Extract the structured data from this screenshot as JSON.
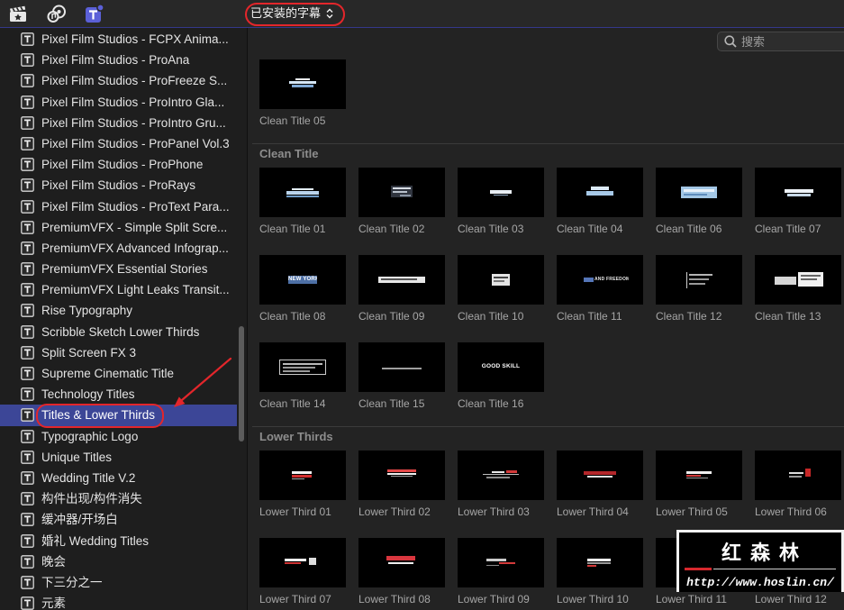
{
  "toolbar": {
    "icons": {
      "libraries": "clapperboard-icon",
      "photos_audio": "photos-audio-icon",
      "titles_generators": "titles-generators-icon"
    },
    "browser_menu_label": "已安装的字幕"
  },
  "search": {
    "placeholder": "搜索"
  },
  "sidebar": {
    "selected_index": 18,
    "items": [
      {
        "label": "Pixel Film Studios - FCPX Anima..."
      },
      {
        "label": "Pixel Film Studios - ProAna"
      },
      {
        "label": "Pixel Film Studios - ProFreeze S..."
      },
      {
        "label": "Pixel Film Studios - ProIntro Gla..."
      },
      {
        "label": "Pixel Film Studios - ProIntro Gru..."
      },
      {
        "label": "Pixel Film Studios - ProPanel Vol.3"
      },
      {
        "label": "Pixel Film Studios - ProPhone"
      },
      {
        "label": "Pixel Film Studios - ProRays"
      },
      {
        "label": "Pixel Film Studios - ProText Para..."
      },
      {
        "label": "PremiumVFX - Simple Split Scre..."
      },
      {
        "label": "PremiumVFX Advanced Infograp..."
      },
      {
        "label": "PremiumVFX Essential Stories"
      },
      {
        "label": "PremiumVFX Light Leaks Transit..."
      },
      {
        "label": "Rise Typography"
      },
      {
        "label": "Scribble Sketch Lower Thirds"
      },
      {
        "label": "Split Screen FX 3"
      },
      {
        "label": "Supreme Cinematic Title"
      },
      {
        "label": "Technology Titles"
      },
      {
        "label": "Titles & Lower Thirds"
      },
      {
        "label": "Typographic Logo"
      },
      {
        "label": "Unique Titles"
      },
      {
        "label": "Wedding Title V.2"
      },
      {
        "label": "构件出现/构件消失"
      },
      {
        "label": "缓冲器/开场白"
      },
      {
        "label": "婚礼 Wedding Titles"
      },
      {
        "label": "晚会"
      },
      {
        "label": "下三分之一"
      },
      {
        "label": "元素"
      }
    ]
  },
  "browser": {
    "sections": [
      {
        "tiles": [
          {
            "label": "Clean Title 05"
          }
        ]
      },
      {
        "header": "Clean Title",
        "tiles": [
          {
            "label": "Clean Title 01"
          },
          {
            "label": "Clean Title 02"
          },
          {
            "label": "Clean Title 03"
          },
          {
            "label": "Clean Title 04"
          },
          {
            "label": "Clean Title 06"
          },
          {
            "label": "Clean Title 07"
          },
          {
            "label": "Clean Title 08",
            "preview_text": "NEW YORK"
          },
          {
            "label": "Clean Title 09"
          },
          {
            "label": "Clean Title 10"
          },
          {
            "label": "Clean Title 11",
            "preview_text": "AND FREEDOM"
          },
          {
            "label": "Clean Title 12"
          },
          {
            "label": "Clean Title 13"
          },
          {
            "label": "Clean Title 14"
          },
          {
            "label": "Clean Title 15"
          },
          {
            "label": "Clean Title 16",
            "preview_text": "GOOD SKILL"
          }
        ]
      },
      {
        "header": "Lower Thirds",
        "tiles": [
          {
            "label": "Lower Third 01"
          },
          {
            "label": "Lower Third 02"
          },
          {
            "label": "Lower Third 03"
          },
          {
            "label": "Lower Third 04"
          },
          {
            "label": "Lower Third 05"
          },
          {
            "label": "Lower Third 06"
          },
          {
            "label": "Lower Third 07"
          },
          {
            "label": "Lower Third 08"
          },
          {
            "label": "Lower Third 09"
          },
          {
            "label": "Lower Third 10"
          },
          {
            "label": "Lower Third 11"
          },
          {
            "label": "Lower Third 12"
          }
        ]
      }
    ]
  },
  "watermark": {
    "brand": "红森林",
    "url": "http://www.hoslin.cn/"
  },
  "colors": {
    "selection": "#3c4697",
    "annotation": "#e3262b",
    "titles_icon": "#5b60d8"
  }
}
